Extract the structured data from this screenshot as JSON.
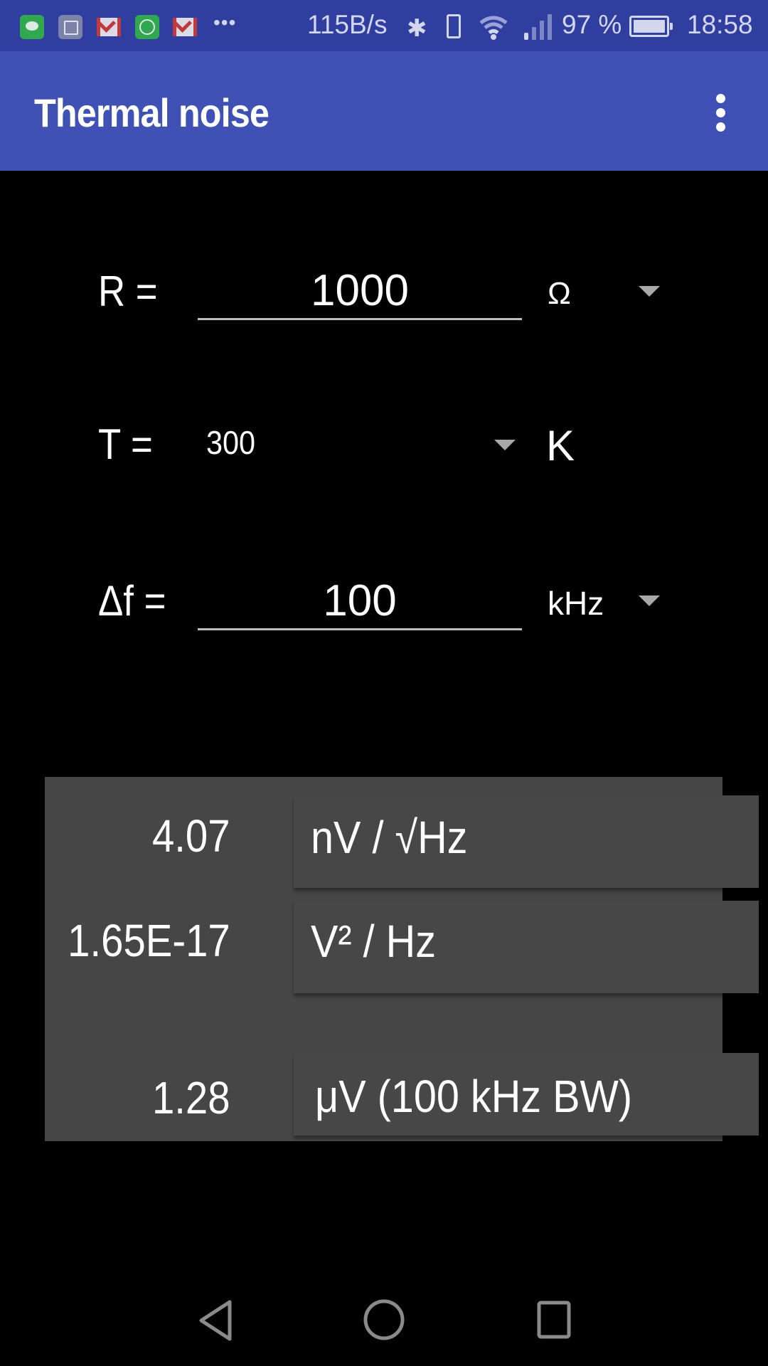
{
  "status_bar": {
    "notification_icons": [
      "messages-icon",
      "gallery-icon",
      "gmail-icon",
      "data-transfer-icon",
      "gmail-icon"
    ],
    "more_label": "•••",
    "net_speed": "115B/s",
    "battery_percent": "97 %",
    "time": "18:58"
  },
  "app_bar": {
    "title": "Thermal noise",
    "overflow_icon": "more-vert-icon"
  },
  "inputs": {
    "resistance": {
      "label": "R =",
      "value": "1000",
      "unit": "Ω"
    },
    "temperature": {
      "label": "T =",
      "value": "300",
      "unit": "K"
    },
    "bandwidth": {
      "label": "Δf =",
      "value": "100",
      "unit": "kHz"
    }
  },
  "results": [
    {
      "value": "4.07",
      "unit": "nV / √Hz"
    },
    {
      "value": "1.65E-17",
      "unit": "V² / Hz"
    },
    {
      "value": "1.28",
      "unit": "μV  (100  kHz BW)"
    }
  ],
  "colors": {
    "status_bar": "#303f9f",
    "app_bar": "#3f51b5",
    "background": "#000000",
    "results_panel": "#464646"
  }
}
